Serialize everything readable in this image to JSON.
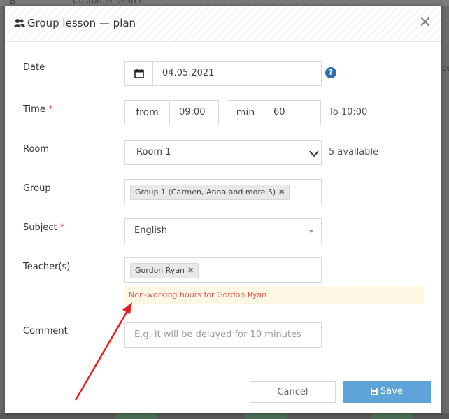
{
  "background": {
    "top_text": "Customer search",
    "top_letter": "B",
    "right_text": "ce"
  },
  "modal": {
    "title": "Group lesson — plan",
    "close_symbol": "×"
  },
  "form": {
    "date": {
      "label": "Date",
      "value": "04.05.2021"
    },
    "time": {
      "label": "Time",
      "required_mark": "*",
      "from_label": "from",
      "from_value": "09:00",
      "min_label": "min",
      "min_value": "60",
      "to_text": "To 10:00"
    },
    "room": {
      "label": "Room",
      "value": "Room 1",
      "available_text": "5 available"
    },
    "group": {
      "label": "Group",
      "tag": "Group 1 (Carmen, Anna and more 5)",
      "remove_symbol": "✖"
    },
    "subject": {
      "label": "Subject",
      "required_mark": "*",
      "value": "English"
    },
    "teachers": {
      "label": "Teacher(s)",
      "tag": "Gordon Ryan",
      "remove_symbol": "✖"
    },
    "warning": "Non-working hours for Gordon Ryan",
    "comment": {
      "label": "Comment",
      "placeholder": "E.g. it will be delayed for 10 minutes"
    }
  },
  "buttons": {
    "cancel": "Cancel",
    "save": "Save"
  },
  "colors": {
    "primary": "#5ea4d8",
    "warning_bg": "#fcf8e3",
    "warning_text": "#e05a5a",
    "required": "#e05555",
    "help": "#2c6fad",
    "arrow": "#e8201a"
  }
}
